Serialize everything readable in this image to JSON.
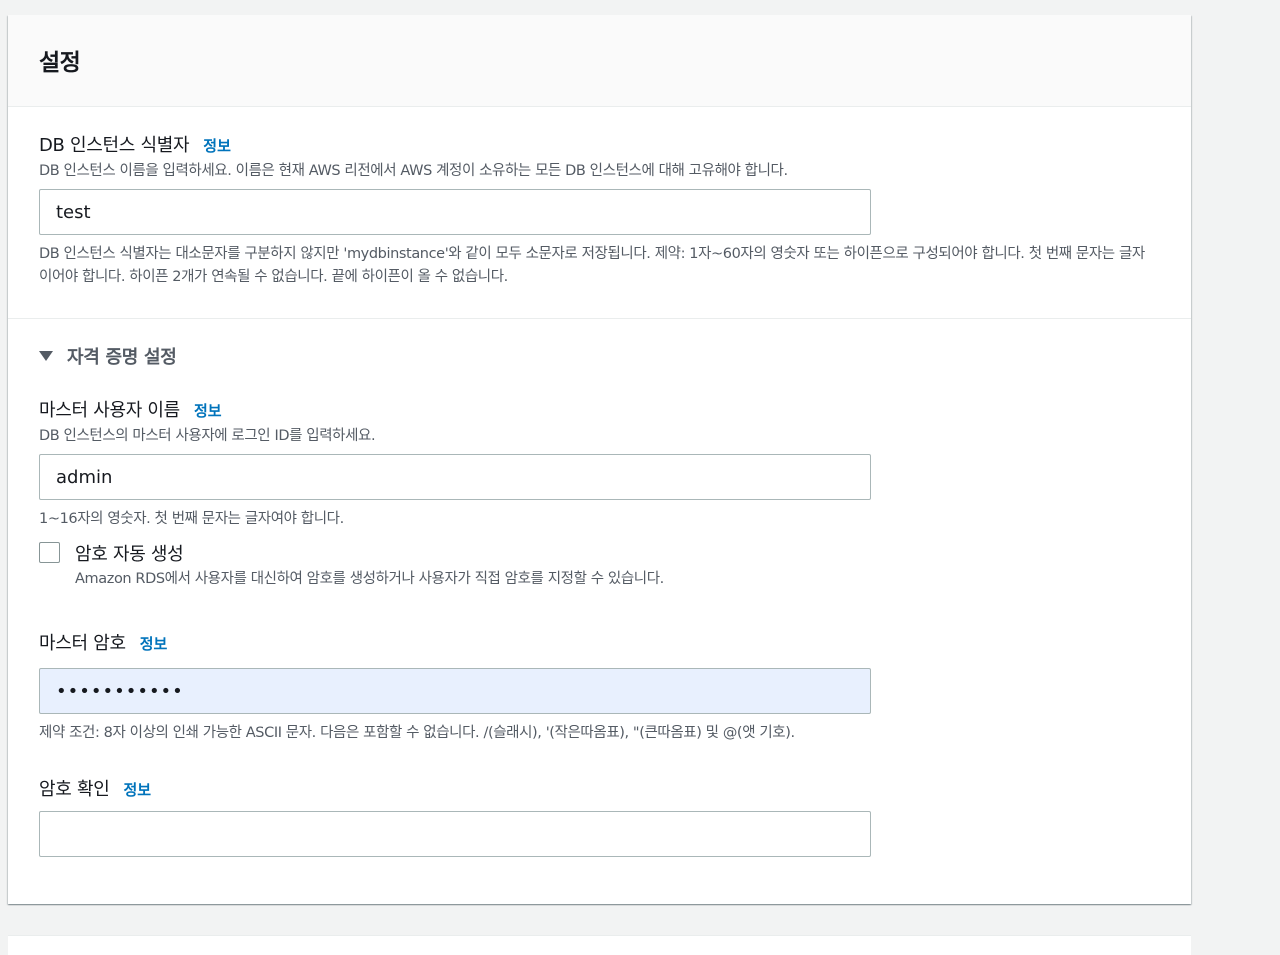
{
  "panel": {
    "title": "설정"
  },
  "db_identifier": {
    "label": "DB 인스턴스 식별자",
    "info": "정보",
    "description": "DB 인스턴스 이름을 입력하세요. 이름은 현재 AWS 리전에서 AWS 계정이 소유하는 모든 DB 인스턴스에 대해 고유해야 합니다.",
    "value": "test",
    "constraint": "DB 인스턴스 식별자는 대소문자를 구분하지 않지만 'mydbinstance'와 같이 모두 소문자로 저장됩니다. 제약: 1자~60자의 영숫자 또는 하이픈으로 구성되어야 합니다. 첫 번째 문자는 글자이어야 합니다. 하이픈 2개가 연속될 수 없습니다. 끝에 하이픈이 올 수 없습니다."
  },
  "credentials": {
    "expander_label": "자격 증명 설정",
    "master_username": {
      "label": "마스터 사용자 이름",
      "info": "정보",
      "description": "DB 인스턴스의 마스터 사용자에 로그인 ID를 입력하세요.",
      "value": "admin",
      "constraint": "1~16자의 영숫자. 첫 번째 문자는 글자여야 합니다."
    },
    "auto_generate": {
      "label": "암호 자동 생성",
      "description": "Amazon RDS에서 사용자를 대신하여 암호를 생성하거나 사용자가 직접 암호를 지정할 수 있습니다.",
      "checked": false
    },
    "master_password": {
      "label": "마스터 암호",
      "info": "정보",
      "value": "•••••••••••",
      "constraint": "제약 조건: 8자 이상의 인쇄 가능한 ASCII 문자. 다음은 포함할 수 없습니다. /(슬래시), '(작은따옴표), \"(큰따옴표) 및 @(앳 기호)."
    },
    "confirm_password": {
      "label": "암호 확인",
      "info": "정보",
      "value": ""
    }
  },
  "colors": {
    "link": "#0073bb",
    "autofill_bg": "#e8f0fe",
    "border": "#aab7b8",
    "secondary_text": "#545b64"
  }
}
